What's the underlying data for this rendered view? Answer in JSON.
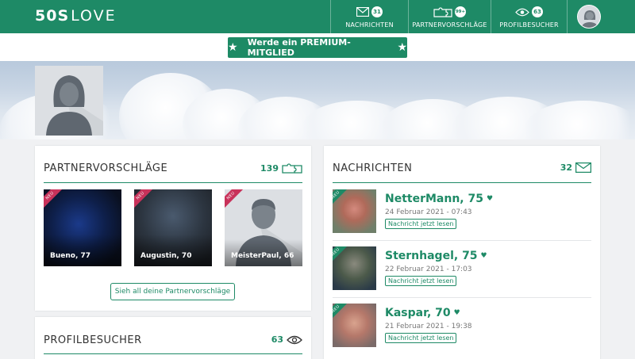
{
  "header": {
    "logo_bold": "50S",
    "logo_light": "LOVE",
    "nav": [
      {
        "label": "NACHRICHTEN",
        "badge": "31",
        "icon": "envelope-icon"
      },
      {
        "label": "PARTNERVORSCHLÄGE",
        "badge": "99+",
        "icon": "puzzle-icon"
      },
      {
        "label": "PROFILBESUCHER",
        "badge": "63",
        "icon": "eye-icon"
      }
    ]
  },
  "premium": {
    "label": "Werde ein PREMIUM-MITGLIED",
    "icon": "star-icon"
  },
  "partner": {
    "title": "PARTNERVORSCHLÄGE",
    "count": "139",
    "items": [
      {
        "name": "Bueno, 77",
        "ribbon": "NEU"
      },
      {
        "name": "Augustin, 70",
        "ribbon": "NEU"
      },
      {
        "name": "MeisterPaul, 66",
        "ribbon": "NEU"
      }
    ],
    "all_button": "Sieh all deine Partnervorschläge"
  },
  "visitors": {
    "title": "PROFILBESUCHER",
    "count": "63"
  },
  "messages": {
    "title": "NACHRICHTEN",
    "count": "32",
    "items": [
      {
        "name": "NetterMann, 75",
        "date": "24 Februar 2021 - 07:43",
        "action": "Nachricht jetzt lesen",
        "ribbon": "NEU"
      },
      {
        "name": "Sternhagel, 75",
        "date": "22 Februar 2021 - 17:03",
        "action": "Nachricht jetzt lesen",
        "ribbon": "NEU"
      },
      {
        "name": "Kaspar, 70",
        "date": "21 Februar 2021 - 19:38",
        "action": "Nachricht jetzt lesen",
        "ribbon": "NEU"
      }
    ]
  },
  "colors": {
    "brand": "#1e8a66",
    "new_ribbon": "#c8325a"
  }
}
